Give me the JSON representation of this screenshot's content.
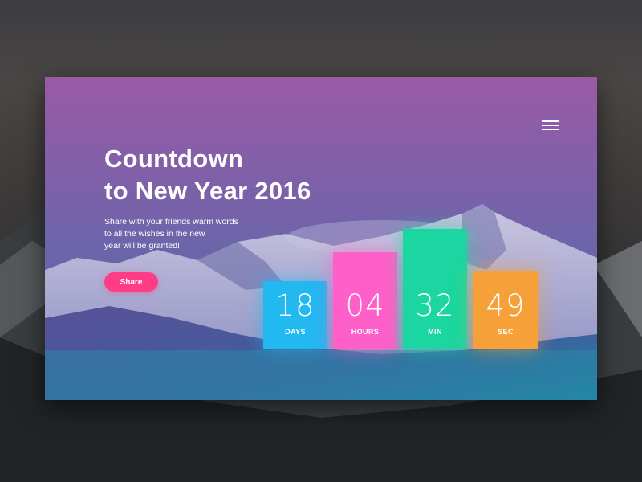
{
  "header": {
    "title_line1": "Countdown",
    "title_line2": "to New Year 2016",
    "menu_icon": "hamburger-menu-icon"
  },
  "intro": {
    "lines": [
      "Share with your friends warm words",
      "to all the wishes in the new",
      "year will be granted!"
    ]
  },
  "share_button": {
    "label": "Share",
    "color": "#ff3d86"
  },
  "countdown": [
    {
      "value": "18",
      "label": "DAYS",
      "color": "#22b8f0"
    },
    {
      "value": "04",
      "label": "HOURS",
      "color": "#ff5fc9"
    },
    {
      "value": "32",
      "label": "MIN",
      "color": "#1bd6a0"
    },
    {
      "value": "49",
      "label": "SEC",
      "color": "#f6a03a"
    }
  ]
}
